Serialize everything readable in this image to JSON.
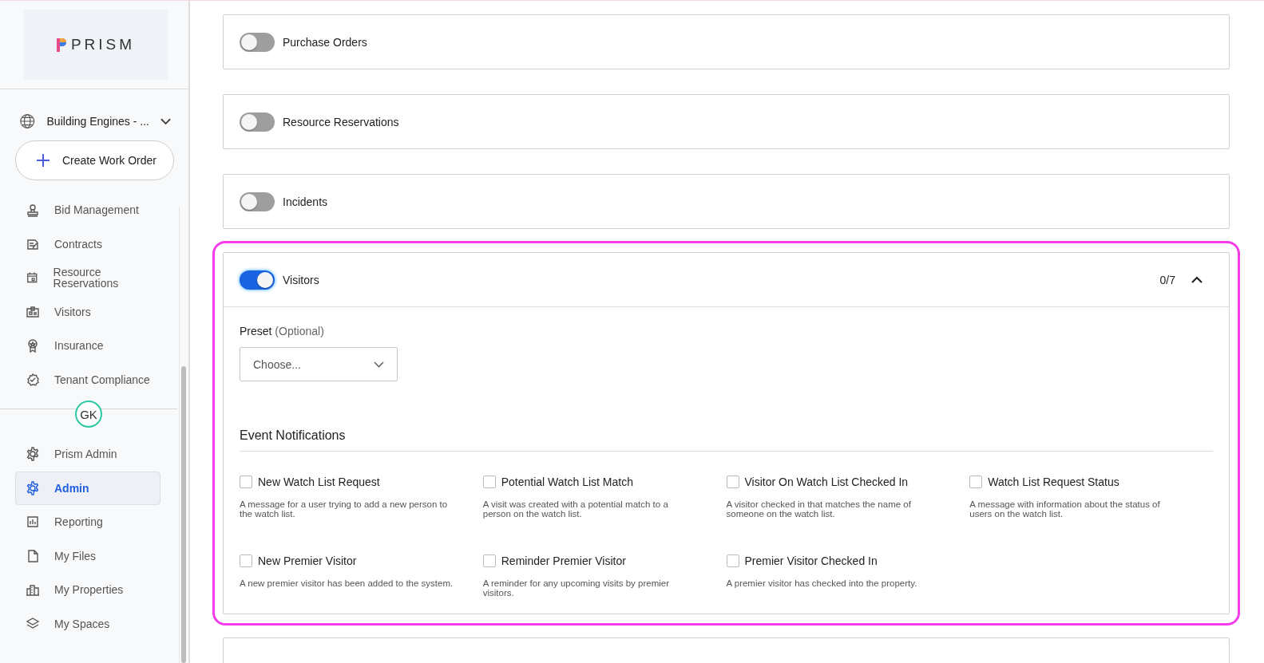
{
  "sidebar": {
    "logo": {
      "text": "PRISM"
    },
    "property_selector": {
      "label": "Building Engines - ..."
    },
    "create_button": {
      "label": "Create Work Order"
    },
    "nav_items": [
      {
        "label": "Bid Management",
        "selected": false
      },
      {
        "label": "Contracts",
        "selected": false
      },
      {
        "label": "Resource Reservations",
        "selected": false
      },
      {
        "label": "Visitors",
        "selected": false
      },
      {
        "label": "Insurance",
        "selected": false
      },
      {
        "label": "Tenant Compliance",
        "selected": false
      }
    ],
    "avatar": {
      "initials": "GK"
    },
    "admin_items": [
      {
        "label": "Prism Admin",
        "selected": false
      },
      {
        "label": "Admin",
        "selected": true
      },
      {
        "label": "Reporting",
        "selected": false
      },
      {
        "label": "My Files",
        "selected": false
      },
      {
        "label": "My Properties",
        "selected": false
      },
      {
        "label": "My Spaces",
        "selected": false
      }
    ]
  },
  "modules": [
    {
      "label": "Purchase Orders",
      "on": false,
      "highlighted": false
    },
    {
      "label": "Resource Reservations",
      "on": false,
      "highlighted": false
    },
    {
      "label": "Incidents",
      "on": false,
      "highlighted": false
    },
    {
      "label": "Visitors",
      "on": true,
      "highlighted": true,
      "count": "0/7",
      "expanded": true,
      "preset": {
        "label": "Preset",
        "hint": "(Optional)",
        "placeholder": "Choose..."
      },
      "section_title": "Event Notifications",
      "notifications": [
        {
          "label": "New Watch List Request",
          "checked": false,
          "description": "A message for a user trying to add a new person to the watch list."
        },
        {
          "label": "Potential Watch List Match",
          "checked": false,
          "description": "A visit was created with a potential match to a person on the watch list."
        },
        {
          "label": "Visitor On Watch List Checked In",
          "checked": false,
          "description": "A visitor checked in that matches the name of someone on the watch list."
        },
        {
          "label": "Watch List Request Status",
          "checked": false,
          "description": "A message with information about the status of users on the watch list."
        },
        {
          "label": "New Premier Visitor",
          "checked": false,
          "description": "A new premier visitor has been added to the system."
        },
        {
          "label": "Reminder Premier Visitor",
          "checked": false,
          "description": "A reminder for any upcoming visits by premier visitors."
        },
        {
          "label": "Premier Visitor Checked In",
          "checked": false,
          "description": "A premier visitor has checked into the property."
        }
      ]
    }
  ]
}
